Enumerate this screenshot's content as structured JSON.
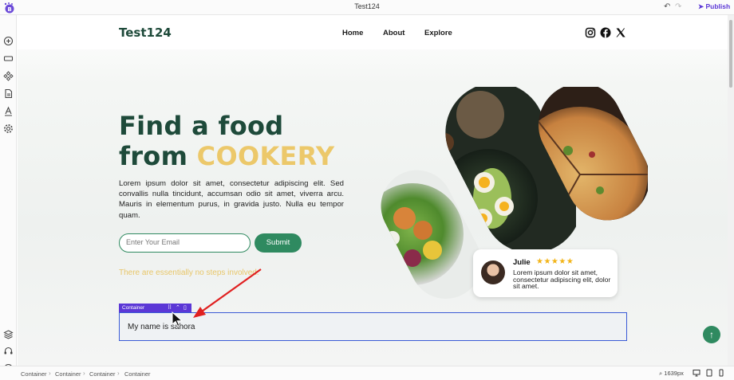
{
  "editor": {
    "title": "Test124",
    "publish_label": "Publish",
    "undo_icon": "undo-icon",
    "redo_icon": "redo-icon"
  },
  "left_tools": [
    "add-icon",
    "section-icon",
    "components-icon",
    "pages-icon",
    "typography-icon",
    "settings-icon",
    "layers-icon",
    "help-icon",
    "info-icon"
  ],
  "site": {
    "brand": "Test124",
    "nav": [
      "Home",
      "About",
      "Explore"
    ],
    "social": [
      "instagram-icon",
      "facebook-icon",
      "x-icon"
    ]
  },
  "hero": {
    "line1": "Find a food",
    "line2_prefix": "from ",
    "line2_accent": "COOKERY",
    "paragraph": "Lorem ipsum dolor sit amet, consectetur adipiscing elit. Sed convallis nulla tincidunt, accumsan odio sit amet, viverra arcu. Mauris in elementum purus, in gravida justo. Nulla eu tempor quam.",
    "email_placeholder": "Enter Your Email",
    "submit_label": "Submit",
    "tagline": "There are essentially no steps involved."
  },
  "review": {
    "name": "Julie",
    "stars": "★★★★★",
    "rating": 5,
    "text": "Lorem ipsum dolor sit amet, consectetur adipiscing elit, dolor sit amet."
  },
  "selected_container": {
    "tag_label": "Container",
    "text": "My name is sahora"
  },
  "statusbar": {
    "breadcrumb": [
      "Container",
      "Container",
      "Container",
      "Container"
    ],
    "zoom": "1639px"
  },
  "colors": {
    "brand_green": "#1e4a3a",
    "accent_gold": "#ecc86a",
    "button_green": "#2f8a60",
    "editor_purple": "#5b37d6",
    "selection_blue": "#3b5bd6"
  }
}
